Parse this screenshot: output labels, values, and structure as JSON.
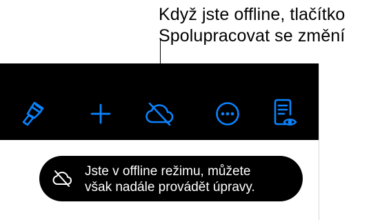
{
  "callout": {
    "line1": "Když jste offline, tlačítko",
    "line2": "Spolupracovat se změní"
  },
  "toolbar": {
    "accent_color": "#0a84ff",
    "background_color": "#000000",
    "buttons": [
      {
        "name": "format-button",
        "icon": "paintbrush-icon"
      },
      {
        "name": "insert-button",
        "icon": "plus-icon"
      },
      {
        "name": "collaborate-button",
        "icon": "cloud-offline-icon"
      },
      {
        "name": "more-button",
        "icon": "ellipsis-circle-icon"
      },
      {
        "name": "reading-view-button",
        "icon": "document-eye-icon"
      }
    ]
  },
  "toast": {
    "icon": "cloud-offline-icon",
    "line1": "Jste v offline režimu, můžete",
    "line2": "však nadále provádět úpravy."
  }
}
